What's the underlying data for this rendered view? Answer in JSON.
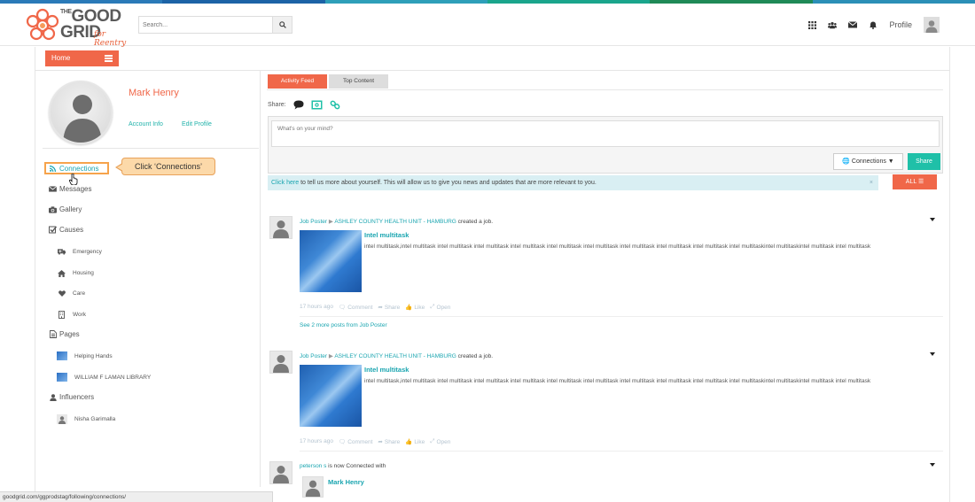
{
  "brand": {
    "logo_line1": "GOOD",
    "logo_line2": "GRID",
    "logo_the": "THE",
    "logo_sub": "for Reentry"
  },
  "search": {
    "placeholder": "Search..."
  },
  "header": {
    "profile_label": "Profile"
  },
  "nav": {
    "home_label": "Home"
  },
  "profile": {
    "name": "Mark Henry",
    "account_info": "Account Info",
    "edit_profile": "Edit Profile"
  },
  "sidebar": {
    "connections": "Connections",
    "messages": "Messages",
    "gallery": "Gallery",
    "causes": "Causes",
    "emergency": "Emergency",
    "housing": "Housing",
    "care": "Care",
    "work": "Work",
    "pages": "Pages",
    "page1": "Helping Hands",
    "page2": "WILLIAM F LAMAN LIBRARY",
    "influencers": "Influencers",
    "influencer1": "Nisha Garimalla"
  },
  "callout": {
    "text": "Click ‘Connections’"
  },
  "tabs": {
    "activity": "Activity Feed",
    "top": "Top Content"
  },
  "composer": {
    "share_label": "Share:",
    "placeholder": "What's on your mind?",
    "audience": "Connections",
    "share_button": "Share"
  },
  "info": {
    "link": "Click here",
    "text": " to tell us more about yourself. This will allow us to give you news and updates that are more relevant to you.",
    "close": "×",
    "filter": "ALL"
  },
  "posts": [
    {
      "author": "Job Poster",
      "target": "ASHLEY COUNTY HEALTH UNIT - HAMBURG",
      "action": " created a job.",
      "title": "Intel multitask",
      "desc": "intel multitask,intel multitask intel multitask intel multitask intel multitask intel multitask intel multitask intel multitask intel multitask intel multitask  intel multitaskintel multitaskintel multitask intel multitask",
      "time": "17 hours ago",
      "comment": "Comment",
      "share": "Share",
      "like": "Like",
      "open": "Open",
      "more": "See 2 more posts from Job Poster"
    },
    {
      "author": "Job Poster",
      "target": "ASHLEY COUNTY HEALTH UNIT - HAMBURG",
      "action": " created a job.",
      "title": "Intel multitask",
      "desc": "intel multitask,intel multitask intel multitask intel multitask intel multitask intel multitask intel multitask intel multitask intel multitask intel multitask  intel multitaskintel multitaskintel multitask intel multitask",
      "time": "17 hours ago",
      "comment": "Comment",
      "share": "Share",
      "like": "Like",
      "open": "Open"
    },
    {
      "author": "peterson s",
      "action": " is now Connected with",
      "connected_name": "Mark Henry"
    }
  ],
  "statusbar": {
    "url": "goodgrid.com/ggprodstag/following/connections/"
  },
  "colors": {
    "accent": "#f06749",
    "teal": "#1aa5b0",
    "share_green": "#1fc0a8",
    "callout_fill": "#fcd9a9",
    "callout_border": "#f6a34b"
  }
}
